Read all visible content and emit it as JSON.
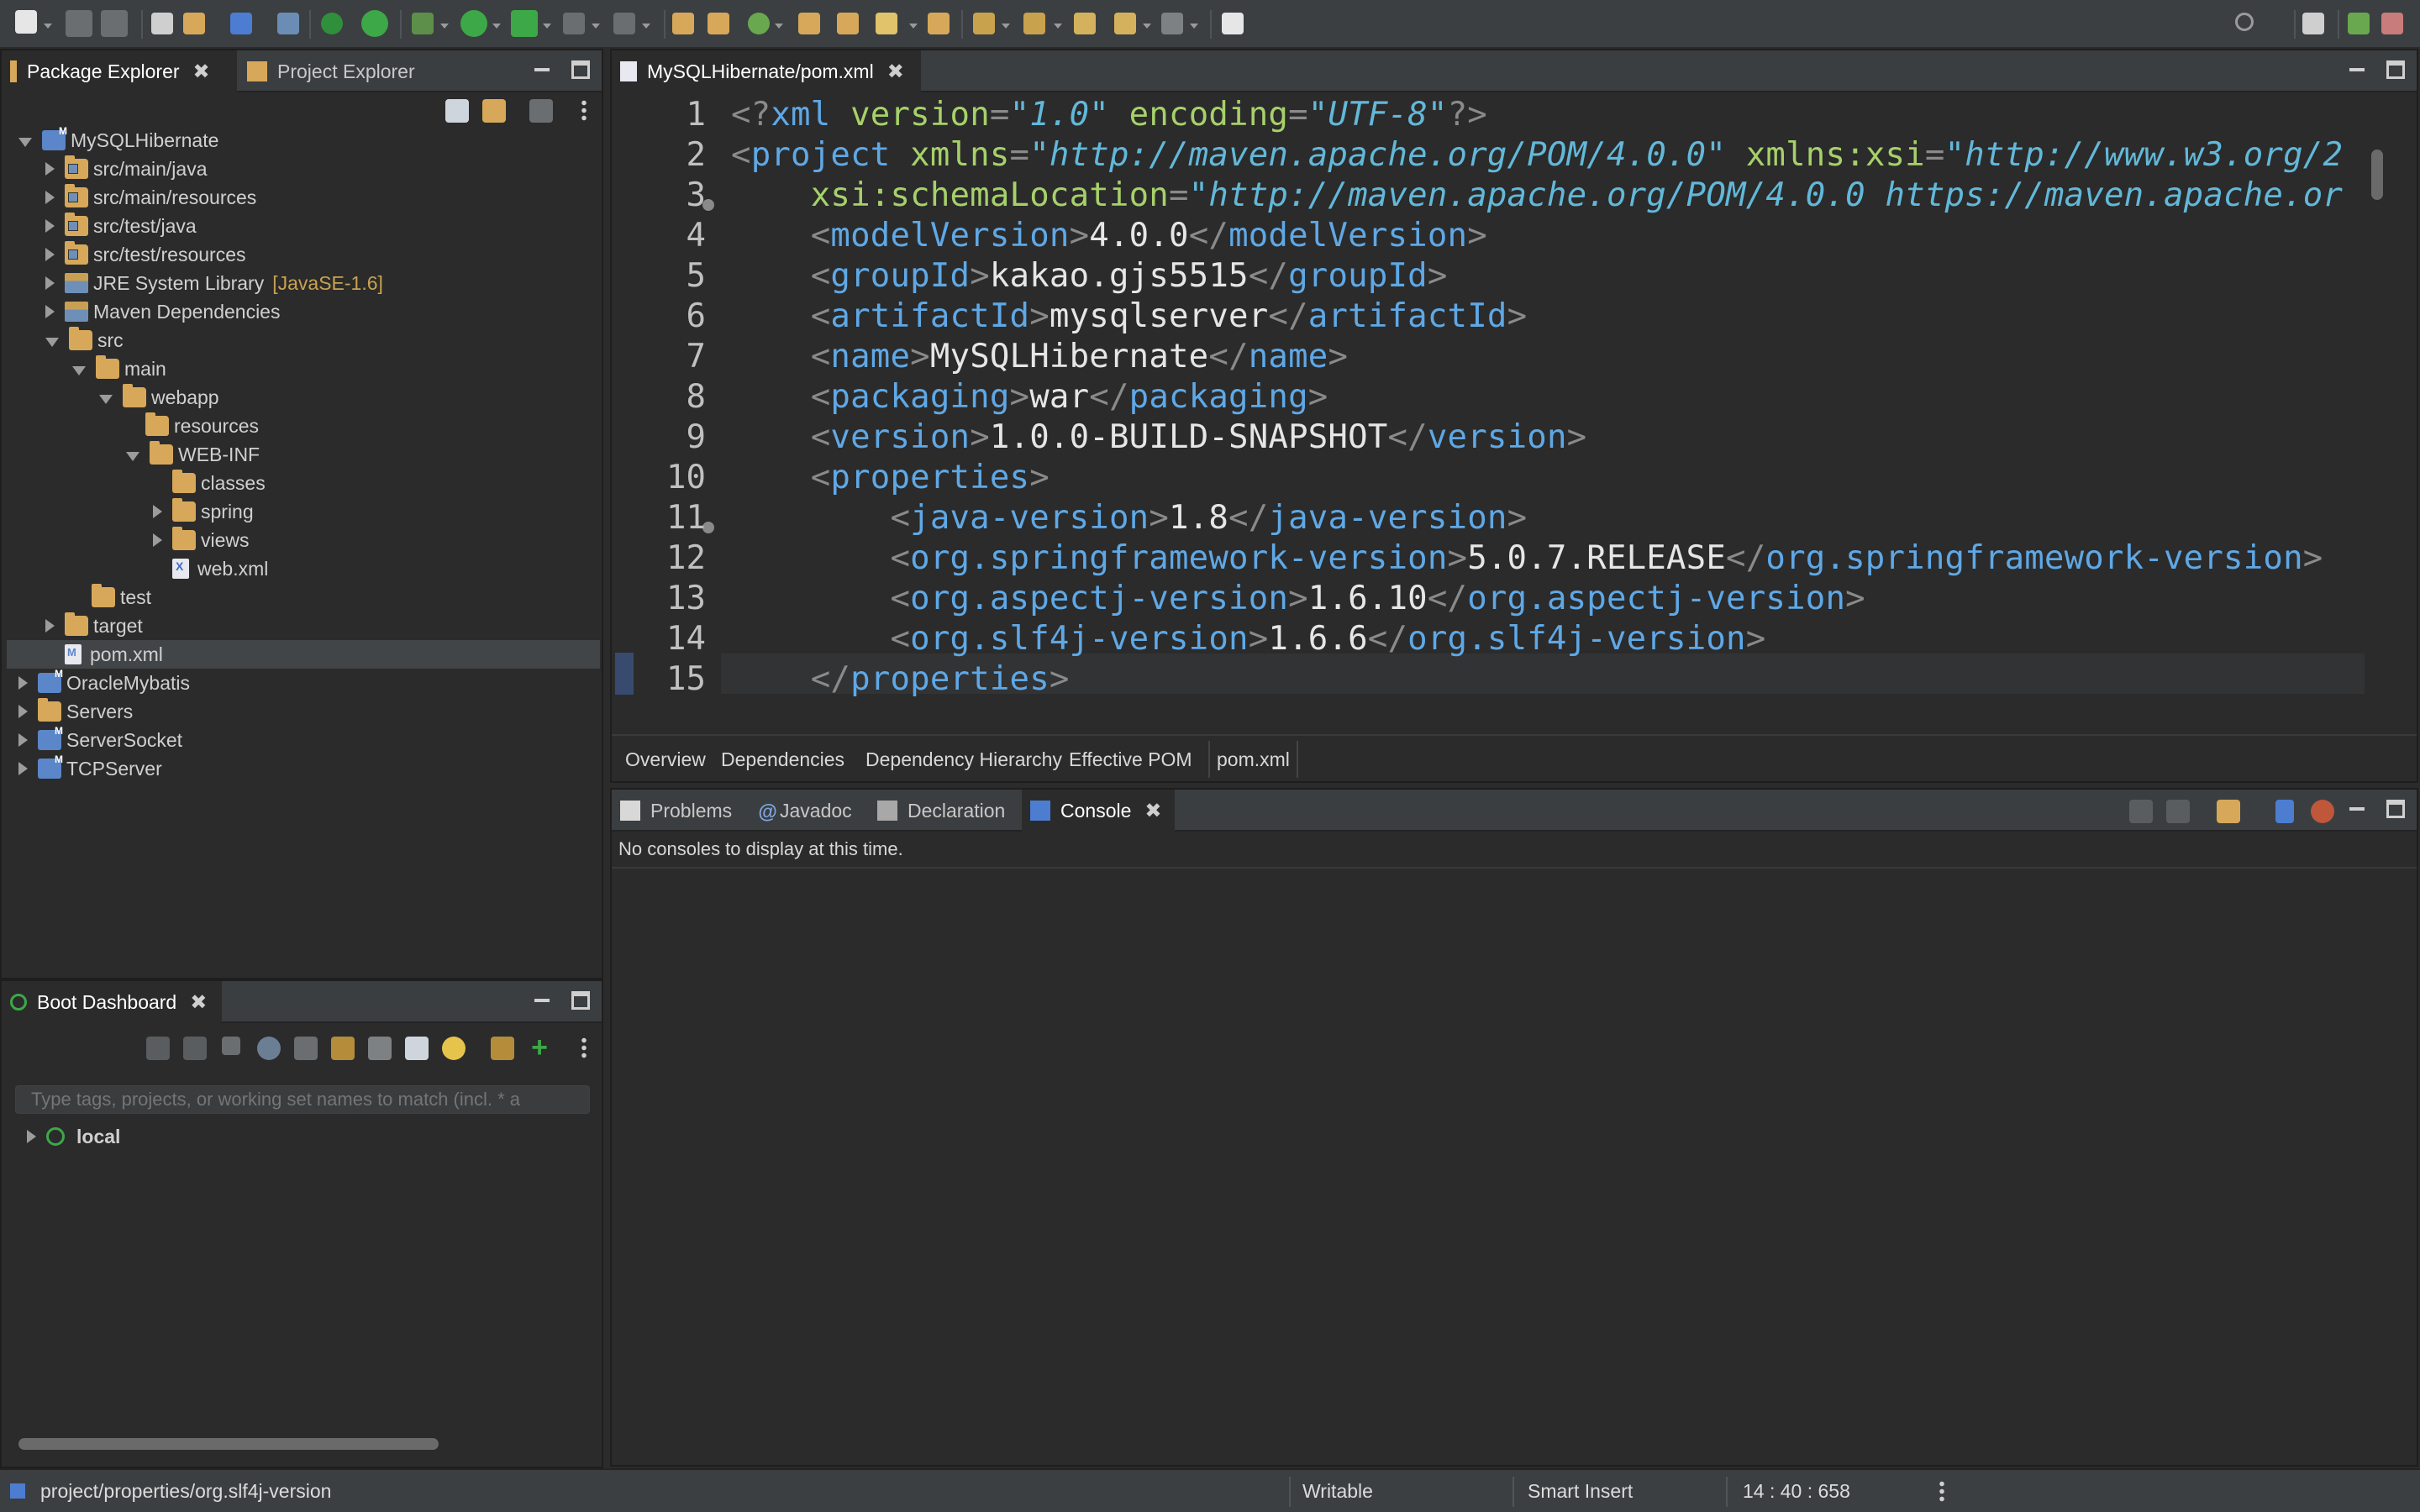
{
  "package_explorer": {
    "tabs": [
      {
        "label": "Package Explorer",
        "active": true
      },
      {
        "label": "Project Explorer",
        "active": false
      }
    ],
    "tree": [
      {
        "label": "MySQLHibernate",
        "depth": 0,
        "state": "open",
        "icon": "project-icon"
      },
      {
        "label": "src/main/java",
        "depth": 1,
        "state": "closed",
        "icon": "source-folder-icon"
      },
      {
        "label": "src/main/resources",
        "depth": 1,
        "state": "closed",
        "icon": "source-folder-icon"
      },
      {
        "label": "src/test/java",
        "depth": 1,
        "state": "closed",
        "icon": "source-folder-icon"
      },
      {
        "label": "src/test/resources",
        "depth": 1,
        "state": "closed",
        "icon": "source-folder-icon"
      },
      {
        "label": "JRE System Library",
        "decoration": "[JavaSE-1.6]",
        "depth": 1,
        "state": "closed",
        "icon": "library-icon"
      },
      {
        "label": "Maven Dependencies",
        "depth": 1,
        "state": "closed",
        "icon": "library-icon"
      },
      {
        "label": "src",
        "depth": 1,
        "state": "open",
        "icon": "folder-icon"
      },
      {
        "label": "main",
        "depth": 2,
        "state": "open",
        "icon": "folder-icon"
      },
      {
        "label": "webapp",
        "depth": 3,
        "state": "open",
        "icon": "folder-icon"
      },
      {
        "label": "resources",
        "depth": 4,
        "state": "none",
        "icon": "folder-icon"
      },
      {
        "label": "WEB-INF",
        "depth": 4,
        "state": "open",
        "icon": "folder-icon"
      },
      {
        "label": "classes",
        "depth": 5,
        "state": "none",
        "icon": "folder-icon"
      },
      {
        "label": "spring",
        "depth": 5,
        "state": "closed",
        "icon": "folder-icon"
      },
      {
        "label": "views",
        "depth": 5,
        "state": "closed",
        "icon": "folder-icon"
      },
      {
        "label": "web.xml",
        "depth": 5,
        "state": "none",
        "icon": "xml-file-icon"
      },
      {
        "label": "test",
        "depth": 2,
        "state": "none",
        "icon": "folder-icon"
      },
      {
        "label": "target",
        "depth": 1,
        "state": "closed",
        "icon": "folder-icon"
      },
      {
        "label": "pom.xml",
        "depth": 1,
        "state": "none",
        "icon": "pom-file-icon",
        "selected": true
      },
      {
        "label": "OracleMybatis",
        "depth": 0,
        "state": "closed",
        "icon": "project-icon"
      },
      {
        "label": "Servers",
        "depth": 0,
        "state": "closed",
        "icon": "folder-icon"
      },
      {
        "label": "ServerSocket",
        "depth": 0,
        "state": "closed",
        "icon": "project-icon"
      },
      {
        "label": "TCPServer",
        "depth": 0,
        "state": "closed",
        "icon": "project-icon"
      }
    ]
  },
  "boot_dashboard": {
    "tab_label": "Boot Dashboard",
    "filter_placeholder": "Type tags, projects, or working set names to match (incl. * a",
    "items": [
      {
        "label": "local"
      }
    ]
  },
  "editor": {
    "tab_label": "MySQLHibernate/pom.xml",
    "lines": [
      [
        [
          "br",
          "<?"
        ],
        [
          "tag",
          "xml"
        ],
        [
          "txt",
          " "
        ],
        [
          "attr",
          "version"
        ],
        [
          "br",
          "="
        ],
        [
          "str",
          "\"1.0\""
        ],
        [
          "txt",
          " "
        ],
        [
          "attr",
          "encoding"
        ],
        [
          "br",
          "="
        ],
        [
          "str",
          "\"UTF-8\""
        ],
        [
          "br",
          "?>"
        ]
      ],
      [
        [
          "br",
          "<"
        ],
        [
          "tag",
          "project"
        ],
        [
          "txt",
          " "
        ],
        [
          "attr",
          "xmlns"
        ],
        [
          "br",
          "="
        ],
        [
          "str",
          "\"http://maven.apache.org/POM/4.0.0\""
        ],
        [
          "txt",
          " "
        ],
        [
          "attr",
          "xmlns:xsi"
        ],
        [
          "br",
          "="
        ],
        [
          "str",
          "\"http://www.w3.org/2"
        ]
      ],
      [
        [
          "txt",
          "    "
        ],
        [
          "attr",
          "xsi:schemaLocation"
        ],
        [
          "br",
          "="
        ],
        [
          "str",
          "\"http://maven.apache.org/POM/4.0.0 https://maven.apache.or"
        ]
      ],
      [
        [
          "txt",
          "    "
        ],
        [
          "br",
          "<"
        ],
        [
          "tag",
          "modelVersion"
        ],
        [
          "br",
          ">"
        ],
        [
          "txt",
          "4.0.0"
        ],
        [
          "br",
          "</"
        ],
        [
          "tag",
          "modelVersion"
        ],
        [
          "br",
          ">"
        ]
      ],
      [
        [
          "txt",
          "    "
        ],
        [
          "br",
          "<"
        ],
        [
          "tag",
          "groupId"
        ],
        [
          "br",
          ">"
        ],
        [
          "txt",
          "kakao.gjs5515"
        ],
        [
          "br",
          "</"
        ],
        [
          "tag",
          "groupId"
        ],
        [
          "br",
          ">"
        ]
      ],
      [
        [
          "txt",
          "    "
        ],
        [
          "br",
          "<"
        ],
        [
          "tag",
          "artifactId"
        ],
        [
          "br",
          ">"
        ],
        [
          "txt",
          "mysqlserver"
        ],
        [
          "br",
          "</"
        ],
        [
          "tag",
          "artifactId"
        ],
        [
          "br",
          ">"
        ]
      ],
      [
        [
          "txt",
          "    "
        ],
        [
          "br",
          "<"
        ],
        [
          "tag",
          "name"
        ],
        [
          "br",
          ">"
        ],
        [
          "txt",
          "MySQLHibernate"
        ],
        [
          "br",
          "</"
        ],
        [
          "tag",
          "name"
        ],
        [
          "br",
          ">"
        ]
      ],
      [
        [
          "txt",
          "    "
        ],
        [
          "br",
          "<"
        ],
        [
          "tag",
          "packaging"
        ],
        [
          "br",
          ">"
        ],
        [
          "txt",
          "war"
        ],
        [
          "br",
          "</"
        ],
        [
          "tag",
          "packaging"
        ],
        [
          "br",
          ">"
        ]
      ],
      [
        [
          "txt",
          "    "
        ],
        [
          "br",
          "<"
        ],
        [
          "tag",
          "version"
        ],
        [
          "br",
          ">"
        ],
        [
          "txt",
          "1.0.0-BUILD-SNAPSHOT"
        ],
        [
          "br",
          "</"
        ],
        [
          "tag",
          "version"
        ],
        [
          "br",
          ">"
        ]
      ],
      [
        [
          "txt",
          "    "
        ],
        [
          "br",
          "<"
        ],
        [
          "tag",
          "properties"
        ],
        [
          "br",
          ">"
        ]
      ],
      [
        [
          "txt",
          "        "
        ],
        [
          "br",
          "<"
        ],
        [
          "tag",
          "java-version"
        ],
        [
          "br",
          ">"
        ],
        [
          "txt",
          "1.8"
        ],
        [
          "br",
          "</"
        ],
        [
          "tag",
          "java-version"
        ],
        [
          "br",
          ">"
        ]
      ],
      [
        [
          "txt",
          "        "
        ],
        [
          "br",
          "<"
        ],
        [
          "tag",
          "org.springframework-version"
        ],
        [
          "br",
          ">"
        ],
        [
          "txt",
          "5.0.7.RELEASE"
        ],
        [
          "br",
          "</"
        ],
        [
          "tag",
          "org.springframework-version"
        ],
        [
          "br",
          ">"
        ]
      ],
      [
        [
          "txt",
          "        "
        ],
        [
          "br",
          "<"
        ],
        [
          "tag",
          "org.aspectj-version"
        ],
        [
          "br",
          ">"
        ],
        [
          "txt",
          "1.6.10"
        ],
        [
          "br",
          "</"
        ],
        [
          "tag",
          "org.aspectj-version"
        ],
        [
          "br",
          ">"
        ]
      ],
      [
        [
          "txt",
          "        "
        ],
        [
          "br",
          "<"
        ],
        [
          "tag",
          "org.slf4j-version"
        ],
        [
          "br",
          ">"
        ],
        [
          "txt",
          "1.6.6"
        ],
        [
          "br",
          "</"
        ],
        [
          "tag",
          "org.slf4j-version"
        ],
        [
          "br",
          ">"
        ]
      ],
      [
        [
          "txt",
          "    "
        ],
        [
          "br",
          "</"
        ],
        [
          "tag",
          "properties"
        ],
        [
          "br",
          ">"
        ]
      ]
    ],
    "bottom_tabs": [
      "Overview",
      "Dependencies",
      "Dependency Hierarchy",
      "Effective POM",
      "pom.xml"
    ],
    "active_bottom_tab": "pom.xml"
  },
  "console_panel": {
    "tabs": [
      {
        "label": "Problems",
        "icon": "problems-icon"
      },
      {
        "label": "Javadoc",
        "icon": "javadoc-icon"
      },
      {
        "label": "Declaration",
        "icon": "declaration-icon"
      },
      {
        "label": "Console",
        "icon": "console-icon",
        "active": true
      }
    ],
    "message": "No consoles to display at this time."
  },
  "status_bar": {
    "path": "project/properties/org.slf4j-version",
    "mode": "Writable",
    "insert_mode": "Smart Insert",
    "position": "14 : 40 : 658"
  },
  "colors": {
    "background": "#2b2b2b",
    "toolbar": "#3b3f42",
    "xml_tag": "#5fa8e6",
    "xml_attr": "#a6d16a",
    "xml_string": "#62b8d9",
    "folder": "#d7a85a"
  }
}
